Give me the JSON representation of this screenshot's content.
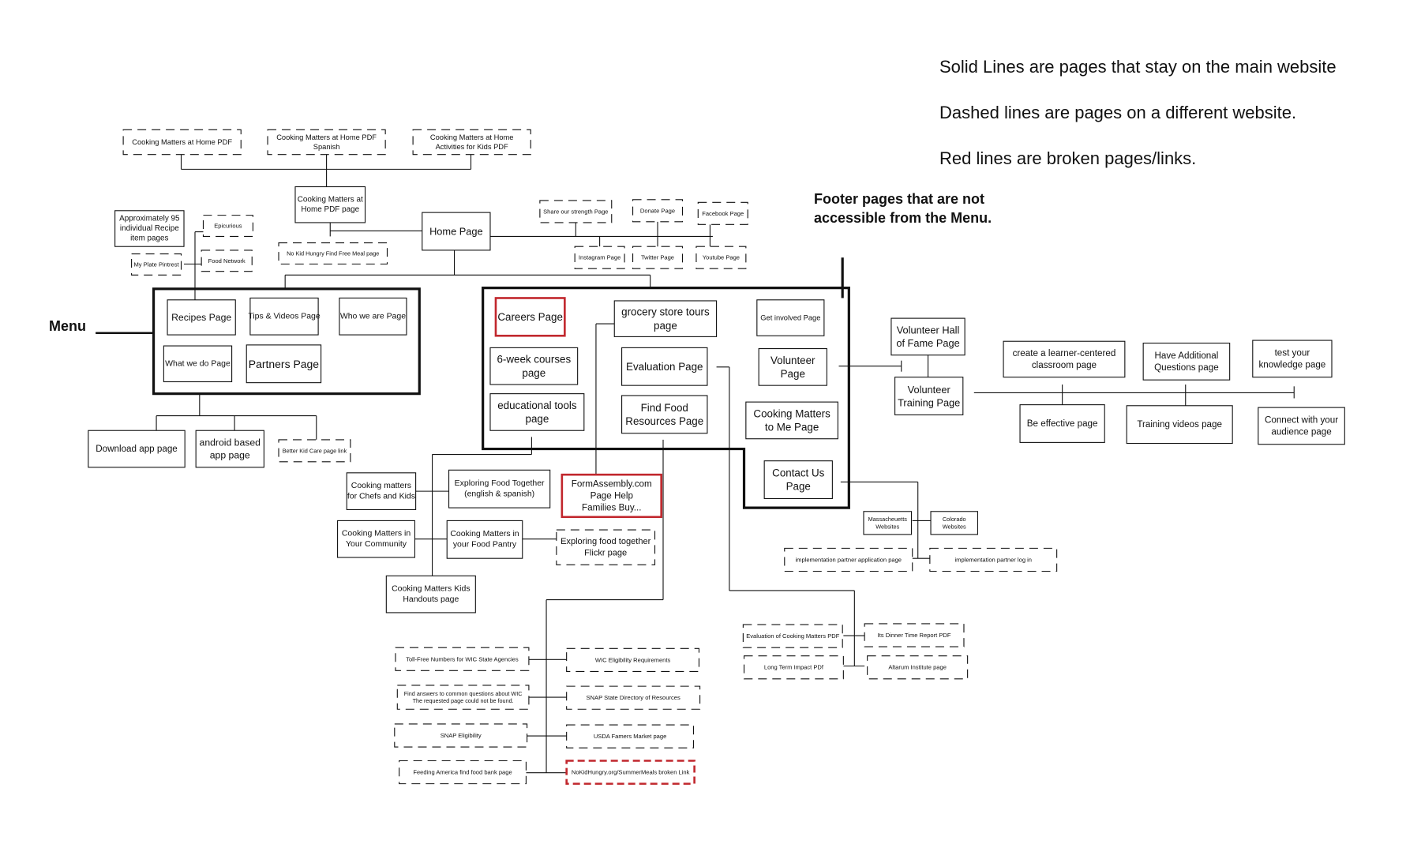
{
  "legend": {
    "solid": "Solid Lines are pages that stay on the main website",
    "dashed": "Dashed lines are pages on a different website.",
    "red": "Red lines are broken pages/links."
  },
  "footer_note": [
    "Footer pages that are not",
    "accessible from the Menu."
  ],
  "menu_label": "Menu",
  "colors": {
    "line": "#111111",
    "broken": "#c1272d"
  },
  "nodes": {
    "cm_home_pdf": [
      "Cooking Matters at Home PDF"
    ],
    "cm_home_pdf_spanish": [
      "Cooking Matters at Home PDF",
      "Spanish"
    ],
    "cm_home_kids_pdf": [
      "Cooking Matters at Home",
      "Activities for Kids PDF"
    ],
    "cm_home_pdf_page": [
      "Cooking Matters at",
      "Home PDF page"
    ],
    "no_kid_hungry_find": [
      "No Kid Hungry Find Free Meal page"
    ],
    "home_page": [
      "Home  Page"
    ],
    "recipes_95": [
      "Approximately 95",
      "individual Recipe",
      "item pages"
    ],
    "epicurious": [
      "Epicurious"
    ],
    "my_plate": [
      "My Plate Pintrest"
    ],
    "food_network": [
      "Food Network"
    ],
    "share_strength": [
      "Share our strength Page"
    ],
    "donate": [
      "Donate Page"
    ],
    "facebook": [
      "Facebook Page"
    ],
    "instagram": [
      "Instagram Page"
    ],
    "twitter": [
      "Twitter Page"
    ],
    "youtube": [
      "Youtube Page"
    ],
    "recipes_page": [
      "Recipes Page"
    ],
    "tips_videos": [
      "Tips & Videos Page"
    ],
    "who_we_are": [
      "Who we are Page"
    ],
    "what_we_do": [
      "What we do Page"
    ],
    "partners": [
      "Partners Page"
    ],
    "download_app": [
      "Download app page"
    ],
    "android_app": [
      "android based",
      "app page"
    ],
    "better_kid_care": [
      "Better Kid Care page link"
    ],
    "careers": [
      "Careers Page"
    ],
    "grocery_tours": [
      "grocery store tours",
      "page"
    ],
    "get_involved": [
      "Get involved Page"
    ],
    "six_week": [
      "6-week courses",
      "page"
    ],
    "evaluation": [
      "Evaluation Page"
    ],
    "volunteer": [
      "Volunteer",
      "Page"
    ],
    "educational_tools": [
      "educational tools",
      "page"
    ],
    "find_food": [
      "Find Food",
      "Resources Page"
    ],
    "cm_to_me": [
      "Cooking Matters",
      "to Me Page"
    ],
    "contact_us": [
      "Contact Us",
      "Page"
    ],
    "vol_hall_fame": [
      "Volunteer Hall",
      "of Fame Page"
    ],
    "vol_training": [
      "Volunteer",
      "Training Page"
    ],
    "learner_centered": [
      "create a learner-centered",
      "classroom  page"
    ],
    "have_questions": [
      "Have Additional",
      "Questions page"
    ],
    "test_knowledge": [
      "test your",
      "knowledge page"
    ],
    "be_effective": [
      "Be effective page"
    ],
    "training_videos": [
      "Training videos page"
    ],
    "connect_audience": [
      "Connect with your",
      "audience page"
    ],
    "chefs_kids": [
      "Cooking matters",
      "for Chefs and Kids"
    ],
    "exploring_food": [
      "Exploring Food Together",
      "(english & spanish)"
    ],
    "formassembly": [
      "FormAssembly.com",
      "Page Help",
      "Families Buy..."
    ],
    "cm_community": [
      "Cooking Matters in",
      "Your Community"
    ],
    "cm_pantry": [
      "Cooking Matters in",
      "your Food Pantry"
    ],
    "exploring_flickr": [
      "Exploring food together",
      "Flickr page"
    ],
    "kids_handouts": [
      "Cooking Matters Kids",
      "Handouts page"
    ],
    "massachusetts": [
      "Massacheuetts",
      "Websites"
    ],
    "colorado": [
      "Colorado",
      "Websites"
    ],
    "impl_partner_app": [
      "implementation partner application page"
    ],
    "impl_partner_login": [
      "implementation partner log in"
    ],
    "eval_cm_pdf": [
      "Evaluation of Cooking Matters PDF"
    ],
    "dinner_time": [
      "Its Dinner Time Report PDF"
    ],
    "long_term": [
      "Long Term Impact PDf"
    ],
    "altarum": [
      "Altarum Institute page"
    ],
    "wic_toll_free": [
      "Toll-Free Numbers for WIC State Agencies"
    ],
    "wic_eligibility": [
      "WIC Eligibility Requirements"
    ],
    "wic_questions": [
      "Find answers to common questions about WIC",
      "The requested page could not be found."
    ],
    "snap_directory": [
      "SNAP State Directory of Resources"
    ],
    "snap_eligibility": [
      "SNAP Eligibility"
    ],
    "usda_farmers": [
      "USDA Famers Market page"
    ],
    "feeding_america": [
      "Feeding America find food bank page"
    ],
    "nokidhungry_broken": [
      "NoKidHungry.org/SummerMeals broken Link"
    ]
  }
}
